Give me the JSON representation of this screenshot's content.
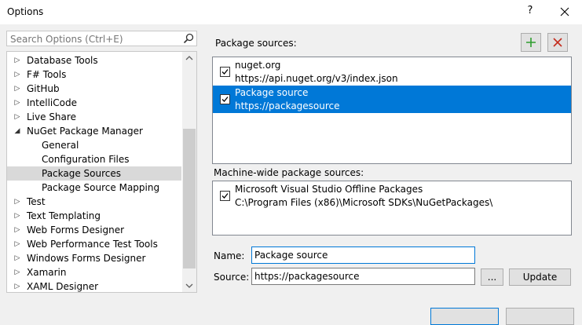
{
  "window": {
    "title": "Options",
    "help_label": "?"
  },
  "search": {
    "placeholder": "Search Options (Ctrl+E)",
    "icon": "search-icon"
  },
  "tree": {
    "items": [
      {
        "label": "Database Tools",
        "expander": "▷",
        "level": 0
      },
      {
        "label": "F# Tools",
        "expander": "▷",
        "level": 0
      },
      {
        "label": "GitHub",
        "expander": "▷",
        "level": 0
      },
      {
        "label": "IntelliCode",
        "expander": "▷",
        "level": 0
      },
      {
        "label": "Live Share",
        "expander": "▷",
        "level": 0
      },
      {
        "label": "NuGet Package Manager",
        "expander": "◢",
        "level": 0
      },
      {
        "label": "General",
        "expander": "",
        "level": 1
      },
      {
        "label": "Configuration Files",
        "expander": "",
        "level": 1
      },
      {
        "label": "Package Sources",
        "expander": "",
        "level": 1,
        "selected": true
      },
      {
        "label": "Package Source Mapping",
        "expander": "",
        "level": 1
      },
      {
        "label": "Test",
        "expander": "▷",
        "level": 0
      },
      {
        "label": "Text Templating",
        "expander": "▷",
        "level": 0
      },
      {
        "label": "Web Forms Designer",
        "expander": "▷",
        "level": 0
      },
      {
        "label": "Web Performance Test Tools",
        "expander": "▷",
        "level": 0
      },
      {
        "label": "Windows Forms Designer",
        "expander": "▷",
        "level": 0
      },
      {
        "label": "Xamarin",
        "expander": "▷",
        "level": 0
      },
      {
        "label": "XAML Designer",
        "expander": "▷",
        "level": 0
      }
    ]
  },
  "package_sources": {
    "heading": "Package sources:",
    "items": [
      {
        "name": "nuget.org",
        "url": "https://api.nuget.org/v3/index.json",
        "checked": true
      },
      {
        "name": "Package source",
        "url": "https://packagesource",
        "checked": true,
        "selected": true
      }
    ]
  },
  "machine_wide": {
    "heading": "Machine-wide package sources:",
    "items": [
      {
        "name": "Microsoft Visual Studio Offline Packages",
        "url": "C:\\Program Files (x86)\\Microsoft SDKs\\NuGetPackages\\",
        "checked": true
      }
    ]
  },
  "form": {
    "name_label": "Name:",
    "name_value": "Package source",
    "source_label": "Source:",
    "source_value": "https://packagesource",
    "browse_label": "...",
    "update_label": "Update"
  },
  "colors": {
    "accent": "#0078d7",
    "add_green": "#2e9e2e",
    "remove_red": "#c42b1c"
  }
}
